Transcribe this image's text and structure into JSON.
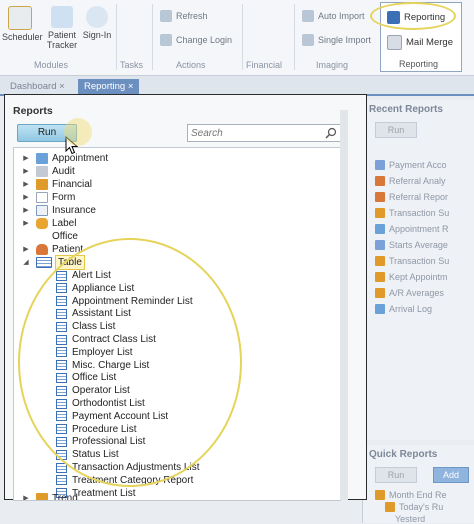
{
  "ribbon": {
    "buttons": [
      {
        "label": "Scheduler",
        "color": "#d9534f"
      },
      {
        "label": "Patient Tracker",
        "color": "#3a7dc9"
      },
      {
        "label": "Sign-In",
        "color": "#3a7dc9"
      }
    ],
    "groups": [
      "Modules",
      "Tasks",
      "Actions",
      "Financial",
      "Imaging"
    ],
    "actions": [
      "Refresh",
      "Change Login"
    ],
    "imaging": [
      "Auto Import",
      "Single Import"
    ],
    "reporting": {
      "items": [
        "Reporting",
        "Mail Merge"
      ],
      "group_label": "Reporting"
    }
  },
  "tabs": [
    "Dashboard",
    "Reporting"
  ],
  "reports": {
    "title": "Reports",
    "run_label": "Run",
    "search_placeholder": "Search",
    "tree": [
      {
        "label": "Appointment",
        "icon": "appointment-icon",
        "color": "#6aa1d8"
      },
      {
        "label": "Audit",
        "icon": "audit-icon",
        "color": "#b0b8c4"
      },
      {
        "label": "Financial",
        "icon": "financial-icon",
        "color": "#e09a2a"
      },
      {
        "label": "Form",
        "icon": "form-icon",
        "color": "#c8d2dd"
      },
      {
        "label": "Insurance",
        "icon": "insurance-icon",
        "color": "#7e9bbf"
      },
      {
        "label": "Label",
        "icon": "label-icon",
        "color": "#e8a531"
      },
      {
        "label": "Office",
        "icon": "office-icon",
        "color": "#ffffff"
      },
      {
        "label": "Patient",
        "icon": "patient-icon",
        "color": "#d9773a"
      },
      {
        "label": "Table",
        "icon": "table-icon",
        "color": "#3b6fb6"
      }
    ],
    "table_children": [
      "Alert List",
      "Appliance List",
      "Appointment Reminder List",
      "Assistant List",
      "Class List",
      "Contract Class List",
      "Employer List",
      "Misc. Charge List",
      "Office List",
      "Operator List",
      "Orthodontist List",
      "Payment Account List",
      "Procedure List",
      "Professional List",
      "Status List",
      "Transaction Adjustments List",
      "Treatment Category Report",
      "Treatment List"
    ],
    "last_node": "Trend"
  },
  "recent_reports": {
    "title": "Recent Reports",
    "run_label": "Run",
    "items": [
      "Payment Acco",
      "Referral Analy",
      "Referral Repor",
      "Transaction Su",
      "Appointment R",
      "Starts Average",
      "Transaction Su",
      "Kept Appointm",
      "A/R Averages",
      "Arrival Log"
    ]
  },
  "quick_reports": {
    "title": "Quick Reports",
    "run_label": "Run",
    "add_label": "Add",
    "items": [
      "Month End Re",
      "Today's Ru",
      "Yesterd"
    ]
  }
}
